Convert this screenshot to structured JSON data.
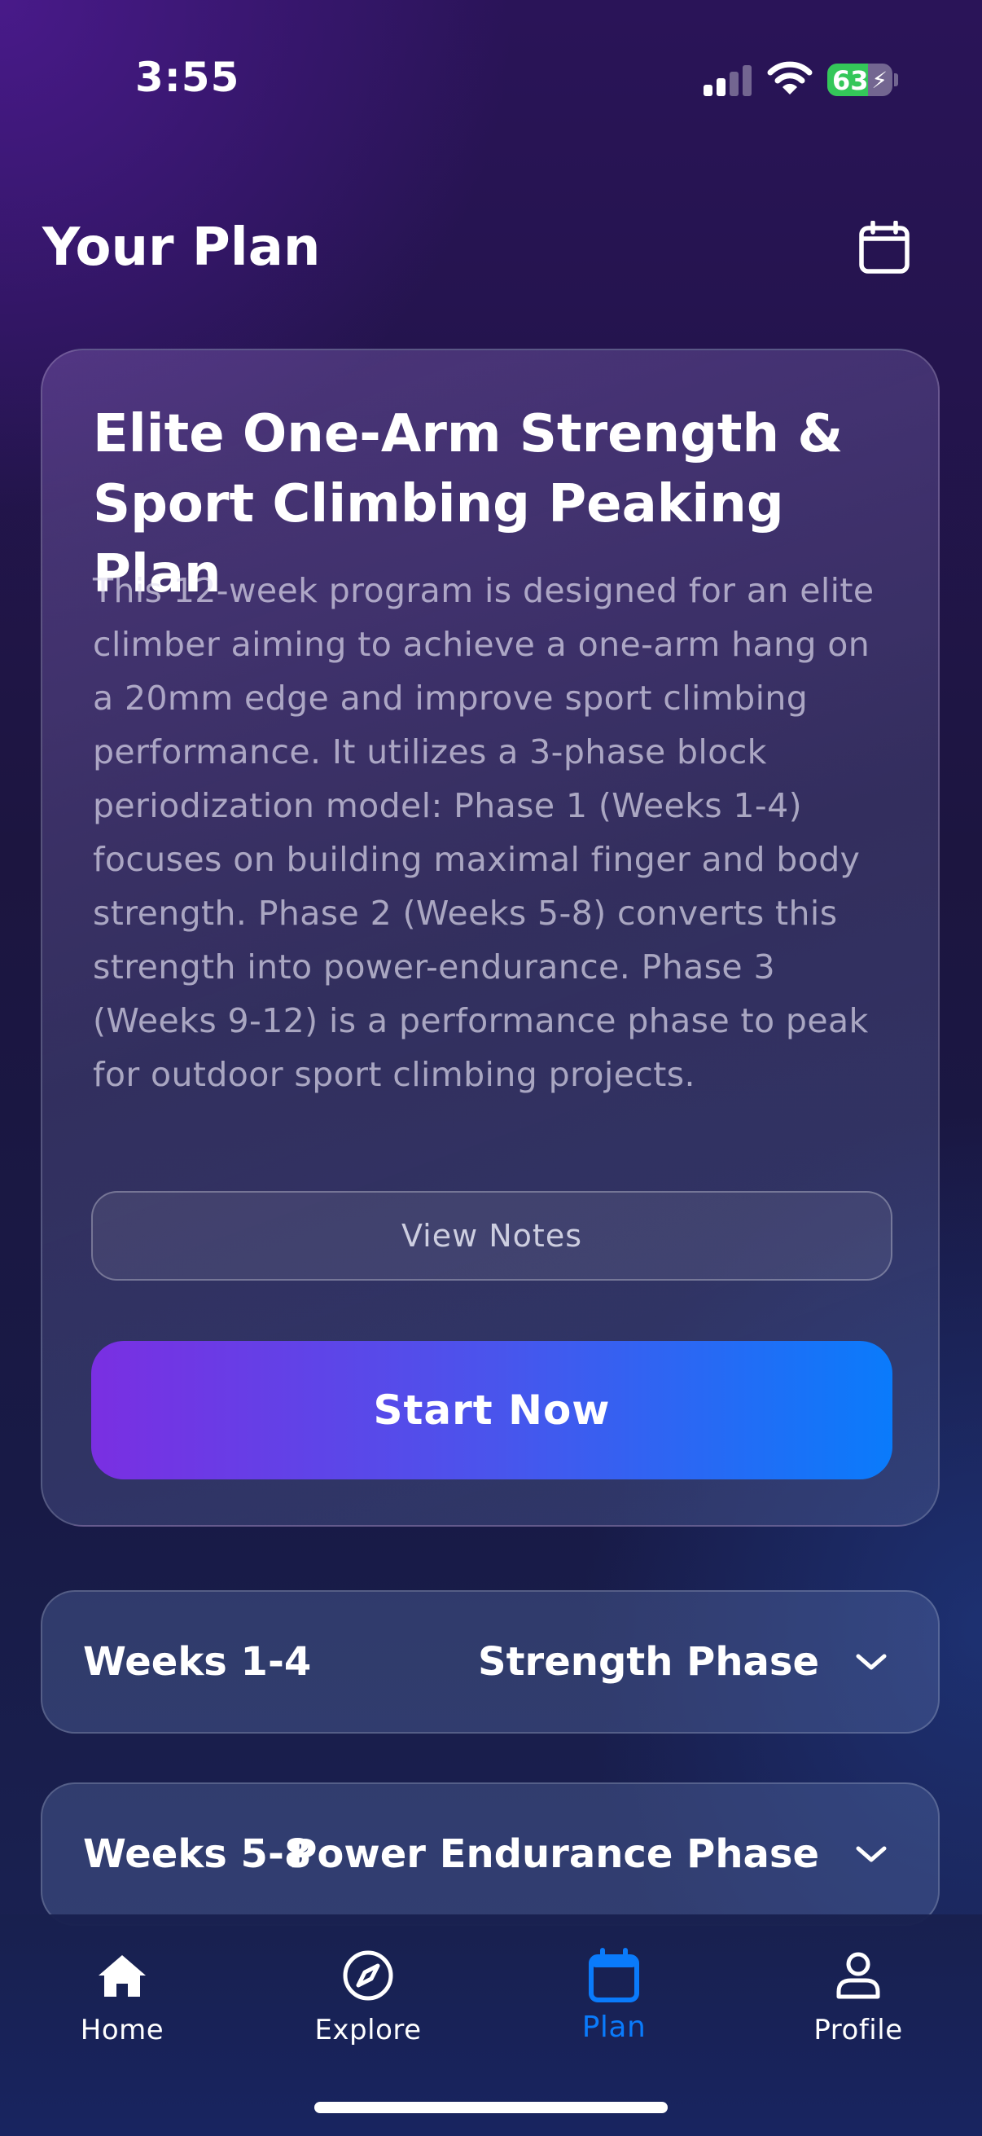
{
  "status_bar": {
    "time": "3:55",
    "battery_level": "63",
    "battery_fraction": 0.63,
    "battery_color": "#34c759",
    "signal_bars_active": 2,
    "signal_bars_total": 4
  },
  "header": {
    "title": "Your Plan",
    "calendar_icon": "calendar-icon"
  },
  "plan": {
    "title": "Elite One-Arm Strength & Sport Climbing Peaking Plan",
    "description": "This 12-week program is designed for an elite climber aiming to achieve a one-arm hang on a 20mm edge and improve sport climbing performance. It utilizes a 3-phase block periodization model: Phase 1 (Weeks 1-4) focuses on building maximal finger and body strength. Phase 2 (Weeks 5-8) converts this strength into power-endurance. Phase 3 (Weeks 9-12) is a performance phase to peak for outdoor sport climbing projects.",
    "view_notes_label": "View Notes",
    "start_now_label": "Start Now",
    "gradient_colors": [
      "#7a2fe2",
      "#0a7bfb"
    ]
  },
  "phases": [
    {
      "weeks": "Weeks 1-4",
      "name": "Strength Phase",
      "icon": "chevron-down-icon"
    },
    {
      "weeks": "Weeks 5-8",
      "name": "Power Endurance Phase",
      "icon": "chevron-down-icon"
    }
  ],
  "tab_bar": {
    "active_color": "#0a7bfb",
    "items": [
      {
        "label": "Home",
        "icon": "home-icon",
        "active": false
      },
      {
        "label": "Explore",
        "icon": "compass-icon",
        "active": false
      },
      {
        "label": "Plan",
        "icon": "calendar-icon",
        "active": true
      },
      {
        "label": "Profile",
        "icon": "person-icon",
        "active": false
      }
    ]
  }
}
